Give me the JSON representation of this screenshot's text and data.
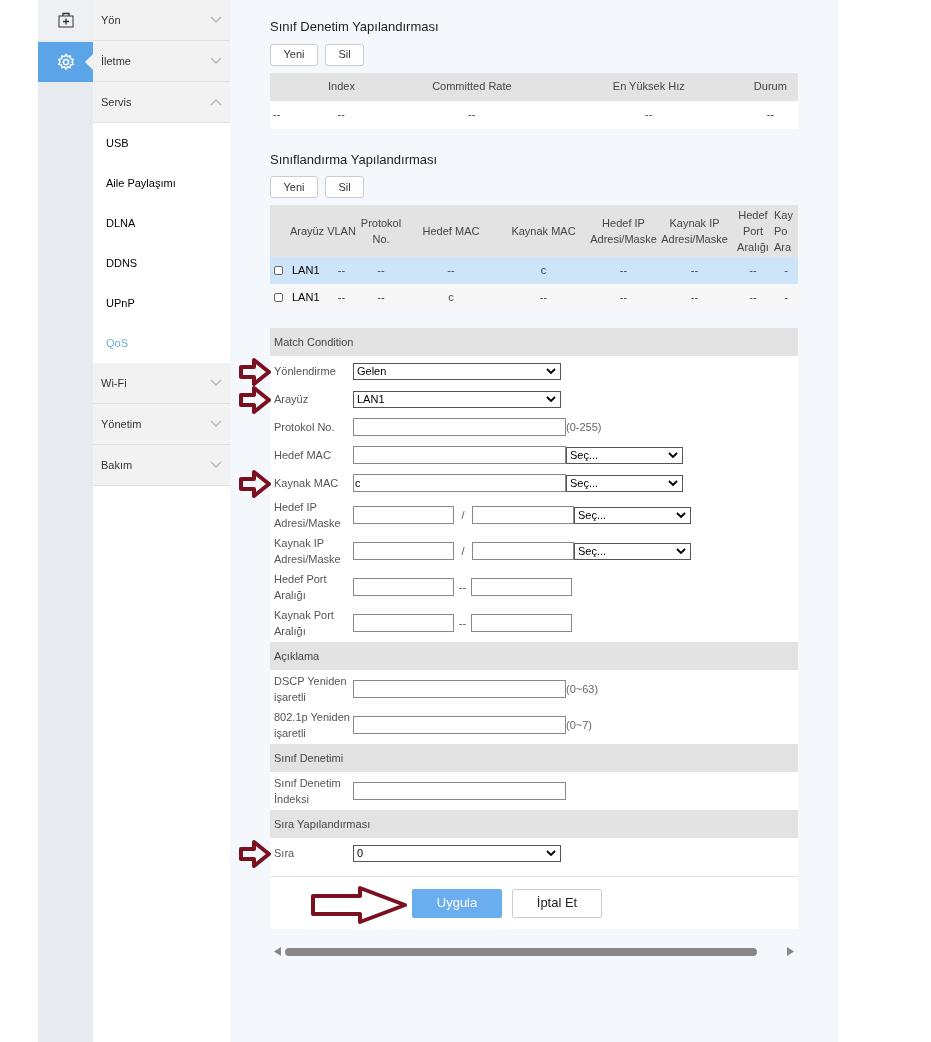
{
  "rail": [
    {
      "kind": "kit",
      "selected": false
    },
    {
      "kind": "gear",
      "selected": true
    }
  ],
  "sidebar": {
    "items": [
      {
        "label": "Yön",
        "expanded": false
      },
      {
        "label": "İletme",
        "expanded": false
      },
      {
        "label": "Servis",
        "expanded": true,
        "children": [
          {
            "label": "USB",
            "selected": false
          },
          {
            "label": "Aile Paylaşımı",
            "selected": false
          },
          {
            "label": "DLNA",
            "selected": false
          },
          {
            "label": "DDNS",
            "selected": false
          },
          {
            "label": "UPnP",
            "selected": false
          },
          {
            "label": "QoS",
            "selected": true
          }
        ]
      },
      {
        "label": "Wi-Fi",
        "expanded": false
      },
      {
        "label": "Yönetim",
        "expanded": false
      },
      {
        "label": "Bakım",
        "expanded": false
      }
    ]
  },
  "policer_section": {
    "title": "Sınıf Denetim Yapılandırması",
    "buttons": [
      "Yeni",
      "Sil"
    ],
    "columns": [
      "Index",
      "Committed Rate",
      "En Yüksek Hız",
      "Durum"
    ],
    "rows": [
      {
        "lead": "--",
        "cells": [
          "--",
          "--",
          "--",
          "--"
        ]
      }
    ]
  },
  "classification_section": {
    "title": "Sınıflandırma Yapılandırması",
    "buttons": [
      "Yeni",
      "Sil"
    ],
    "columns": [
      "Arayüz",
      "VLAN",
      "Protokol No.",
      "Hedef MAC",
      "Kaynak MAC",
      "Hedef IP Adresi/Maske",
      "Kaynak IP Adresi/Maske",
      "Hedef Port Aralığı",
      "Kay Po Ara"
    ],
    "rows": [
      {
        "selected": true,
        "checked": false,
        "cells": [
          "LAN1",
          "--",
          "--",
          "--",
          "c",
          "--",
          "--",
          "--",
          "-"
        ]
      },
      {
        "selected": false,
        "checked": false,
        "cells": [
          "LAN1",
          "--",
          "--",
          "c",
          "--",
          "--",
          "--",
          "--",
          "-"
        ]
      }
    ]
  },
  "form": {
    "groups": [
      {
        "title": "Match Condition",
        "rows": [
          {
            "kind": "select",
            "label": "Yönlendirme",
            "value": "Gelen",
            "arrow_marked": true
          },
          {
            "kind": "select",
            "label": "Arayüz",
            "value": "LAN1",
            "arrow_marked": true
          },
          {
            "kind": "text",
            "label": "Protokol No.",
            "value": "",
            "hint": "(0-255)",
            "arrow_marked": false
          },
          {
            "kind": "mac",
            "label": "Hedef MAC",
            "value": "",
            "option": "Seç...",
            "arrow_marked": false
          },
          {
            "kind": "mac",
            "label": "Kaynak MAC",
            "value": "c",
            "option": "Seç...",
            "arrow_marked": true
          },
          {
            "kind": "ip",
            "label": "Hedef IP Adresi/Maske",
            "separator": "/",
            "option": "Seç...",
            "arrow_marked": false
          },
          {
            "kind": "ip",
            "label": "Kaynak IP Adresi/Maske",
            "separator": "/",
            "option": "Seç...",
            "arrow_marked": false
          },
          {
            "kind": "range",
            "label": "Hedef Port Aralığı",
            "separator": "--",
            "arrow_marked": false
          },
          {
            "kind": "range",
            "label": "Kaynak Port Aralığı",
            "separator": "--",
            "arrow_marked": false
          }
        ]
      },
      {
        "title": "Açıklama",
        "rows": [
          {
            "kind": "text",
            "label": "DSCP Yeniden işaretli",
            "value": "",
            "hint": "(0~63)",
            "arrow_marked": false
          },
          {
            "kind": "text",
            "label": "802.1p Yeniden işaretli",
            "value": "",
            "hint": "(0~7)",
            "arrow_marked": false
          }
        ]
      },
      {
        "title": "Sınıf Denetimi",
        "rows": [
          {
            "kind": "text",
            "label": "Sınıf Denetim İndeksi",
            "value": "",
            "arrow_marked": false
          }
        ]
      },
      {
        "title": "Sıra Yapılandırması",
        "rows": [
          {
            "kind": "select",
            "label": "Sıra",
            "value": "0",
            "arrow_marked": true
          }
        ]
      }
    ],
    "apply_button": {
      "label": "Uygula",
      "arrow_marked": true
    },
    "cancel_button": {
      "label": "İptal Et"
    }
  }
}
